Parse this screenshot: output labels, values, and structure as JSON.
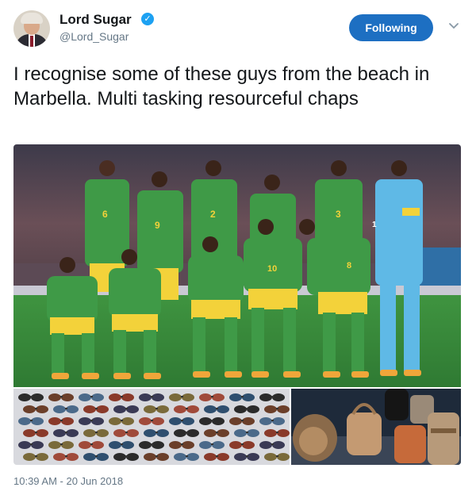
{
  "author": {
    "name": "Lord Sugar",
    "handle": "@Lord_Sugar",
    "verified": true
  },
  "follow_button": {
    "label": "Following"
  },
  "tweet": {
    "text": "I recognise some of these guys from the beach in Marbella. Multi tasking resourceful chaps"
  },
  "photo_team": {
    "jersey_numbers": [
      "6",
      "9",
      "2",
      "3",
      "8",
      "10",
      "1"
    ],
    "colors": {
      "jersey": "#3f9a47",
      "shorts": "#f3d23a",
      "keeper": "#5fb9e6",
      "pitch": "#3b8d3a",
      "crowd": "#5b4650"
    }
  },
  "timestamp": "10:39 AM - 20 Jun 2018",
  "colors": {
    "accent": "#1d6fc2",
    "verified": "#1da1f2",
    "muted": "#657786"
  }
}
